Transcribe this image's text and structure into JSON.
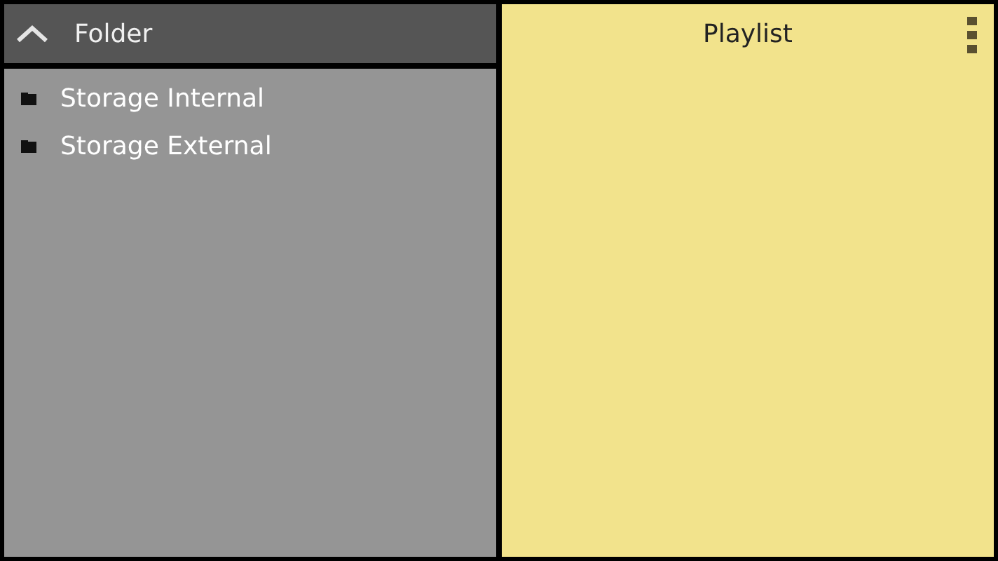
{
  "folder_panel": {
    "title": "Folder",
    "items": [
      {
        "label": "Storage Internal"
      },
      {
        "label": "Storage External"
      }
    ]
  },
  "playlist_panel": {
    "title": "Playlist"
  }
}
